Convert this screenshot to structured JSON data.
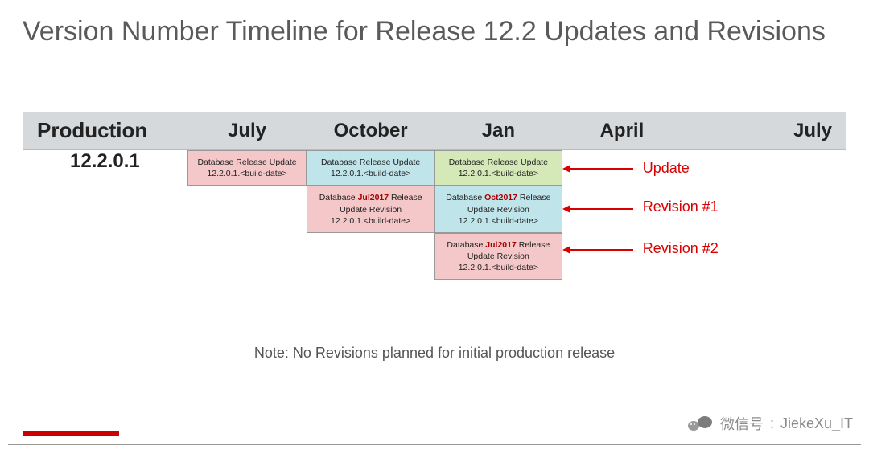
{
  "title": "Version Number Timeline for Release 12.2 Updates and Revisions",
  "headers": {
    "production": "Production",
    "july": "July",
    "october": "October",
    "jan": "Jan",
    "april": "April",
    "july2": "July"
  },
  "version": "12.2.0.1",
  "cells": {
    "july_update_l1": "Database Release Update",
    "july_update_l2": "12.2.0.1.<build-date>",
    "oct_update_l1": "Database Release Update",
    "oct_update_l2": "12.2.0.1.<build-date>",
    "jan_update_l1": "Database Release Update",
    "jan_update_l2": "12.2.0.1.<build-date>",
    "oct_rev_prefix": "Database ",
    "oct_rev_bold": "Jul2017",
    "oct_rev_suffix": " Release",
    "oct_rev_l2": "Update Revision",
    "oct_rev_l3": "12.2.0.1.<build-date>",
    "jan_rev1_prefix": "Database ",
    "jan_rev1_bold": "Oct2017",
    "jan_rev1_suffix": " Release",
    "jan_rev1_l2": "Update Revision",
    "jan_rev1_l3": "12.2.0.1.<build-date>",
    "jan_rev2_prefix": "Database ",
    "jan_rev2_bold": "Jul2017",
    "jan_rev2_suffix": " Release",
    "jan_rev2_l2": "Update Revision",
    "jan_rev2_l3": "12.2.0.1.<build-date>"
  },
  "labels": {
    "update": "Update",
    "revision1": "Revision #1",
    "revision2": "Revision #2"
  },
  "note": "Note:  No Revisions planned for initial production release",
  "watermark": {
    "text_cn": "微信号",
    "text_id": "JiekeXu_IT"
  }
}
